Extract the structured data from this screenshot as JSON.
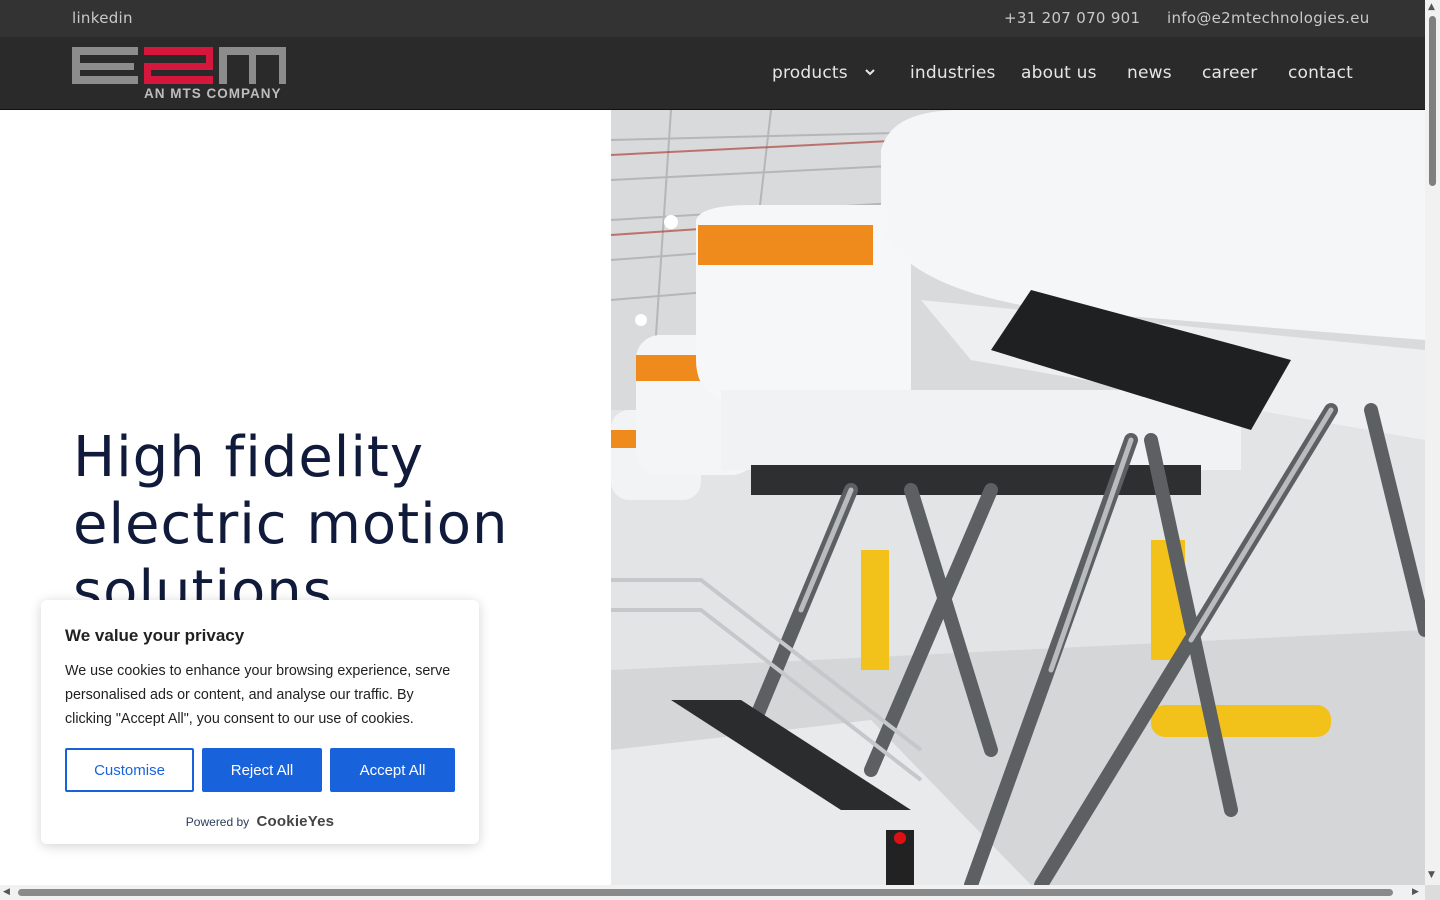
{
  "topbar": {
    "linkedin": "linkedin",
    "phone": "+31 207 070 901",
    "email": "info@e2mtechnologies.eu"
  },
  "logo": {
    "text": "e2m",
    "tagline": "AN MTS COMPANY",
    "colors": {
      "gray": "#8c8c8c",
      "red": "#d5173d"
    }
  },
  "nav": {
    "items": [
      {
        "label": "products",
        "icon": "chevron-down-icon"
      },
      {
        "label": "industries"
      },
      {
        "label": "about us"
      },
      {
        "label": "news"
      },
      {
        "label": "career"
      },
      {
        "label": "contact"
      }
    ]
  },
  "hero": {
    "headline_lines": [
      "High fidelity",
      "electric motion",
      "solutions"
    ],
    "image": "flight-simulators-on-electric-motion-platforms"
  },
  "cookie": {
    "title": "We value your privacy",
    "body": "We use cookies to enhance your browsing experience, serve personalised ads or content, and analyse our traffic. By clicking \"Accept All\", you consent to our use of cookies.",
    "customise": "Customise",
    "reject": "Reject All",
    "accept": "Accept All",
    "powered_by": "Powered by",
    "brand": "CookieYes",
    "accent": "#1863dc"
  }
}
